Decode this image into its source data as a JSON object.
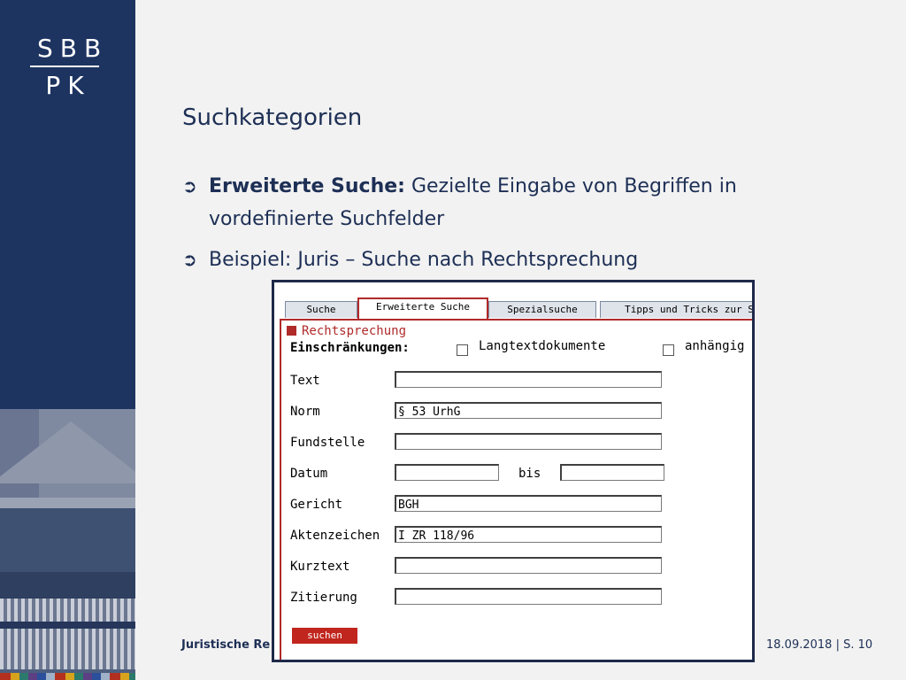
{
  "logo": {
    "line1": "SBB",
    "line2": "PK"
  },
  "slide": {
    "title": "Suchkategorien",
    "bullets": [
      {
        "bold": "Erweiterte Suche:",
        "text": " Gezielte Eingabe von Begriffen in vordefinierte Suchfelder"
      },
      {
        "bold": "",
        "text": "Beispiel: Juris – Suche nach Rechtsprechung"
      }
    ],
    "bullet_glyph": "➲"
  },
  "footer": {
    "left": "Juristische Re",
    "right": "18.09.2018 | S. 10"
  },
  "juris": {
    "tabs": [
      "Suche",
      "Erweiterte Suche",
      "Spezialsuche",
      "Tipps und Tricks zur S"
    ],
    "active_tab": "Erweiterte Suche",
    "section_title": "Rechtsprechung",
    "restrictions_label": "Einschränkungen:",
    "checkboxes": [
      {
        "label": "Langtextdokumente",
        "checked": false
      },
      {
        "label": "anhängig",
        "checked": false
      }
    ],
    "fields": {
      "text": {
        "label": "Text",
        "value": ""
      },
      "norm": {
        "label": "Norm",
        "value": "§ 53 UrhG"
      },
      "fundstelle": {
        "label": "Fundstelle",
        "value": ""
      },
      "datum": {
        "label": "Datum",
        "value": "",
        "to_label": "bis",
        "to_value": ""
      },
      "gericht": {
        "label": "Gericht",
        "value": "BGH"
      },
      "aktenzeichen": {
        "label": "Aktenzeichen",
        "value": "I ZR 118/96"
      },
      "kurztext": {
        "label": "Kurztext",
        "value": ""
      },
      "zitierung": {
        "label": "Zitierung",
        "value": ""
      }
    },
    "search_button": "suchen"
  },
  "colors": {
    "navy": "#1d3461",
    "accent_red": "#b02a2a",
    "text_blue": "#1d2f55"
  }
}
